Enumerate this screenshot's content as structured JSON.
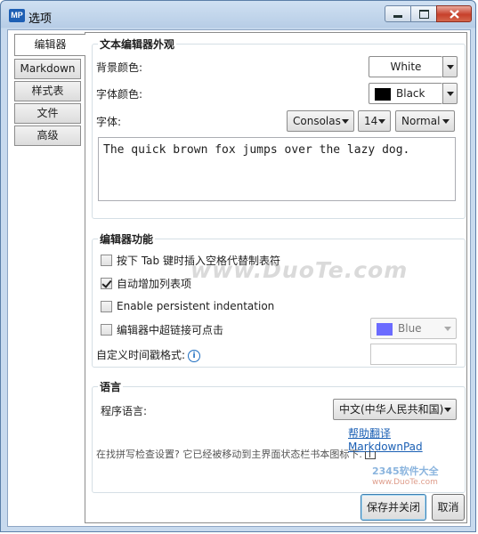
{
  "window": {
    "app_logo": "MP",
    "title": "选项",
    "close_color": "#c7402b"
  },
  "tabs": [
    {
      "label": "编辑器",
      "active": true
    },
    {
      "label": "Markdown",
      "active": false
    },
    {
      "label": "样式表",
      "active": false
    },
    {
      "label": "文件",
      "active": false
    },
    {
      "label": "高级",
      "active": false
    }
  ],
  "appearance": {
    "title": "文本编辑器外观",
    "bg_color_label": "背景颜色:",
    "bg_color_value": "White",
    "font_color_label": "字体颜色:",
    "font_color_value": "Black",
    "font_color_swatch": "#000000",
    "font_label": "字体:",
    "font_family": "Consolas",
    "font_size": "14",
    "font_weight": "Normal",
    "preview_text": "The quick brown fox jumps over the lazy dog."
  },
  "features": {
    "title": "编辑器功能",
    "tab_spaces": {
      "label": "按下 Tab 键时插入空格代替制表符",
      "checked": false
    },
    "auto_list": {
      "label": "自动增加列表项",
      "checked": true
    },
    "persistent_indent": {
      "label": "Enable persistent indentation",
      "checked": false
    },
    "clickable_links": {
      "label": "编辑器中超链接可点击",
      "checked": false
    },
    "link_color_value": "Blue",
    "link_color_swatch": "#6b6bff",
    "timestamp_label": "自定义时间戳格式:",
    "timestamp_value": ""
  },
  "language": {
    "title": "语言",
    "program_lang_label": "程序语言:",
    "program_lang_value": "中文(中华人民共和国)",
    "help_translate": "帮助翻译 MarkdownPad",
    "spellcheck_note": "在找拼写检查设置? 它已经被移动到主界面状态栏书本图标下."
  },
  "buttons": {
    "save_close": "保存并关闭",
    "cancel": "取消"
  },
  "watermark": {
    "text": "www.DuoTe.com",
    "site_logo": "2345软件大全",
    "site_url": "www.DuoTe.com"
  }
}
